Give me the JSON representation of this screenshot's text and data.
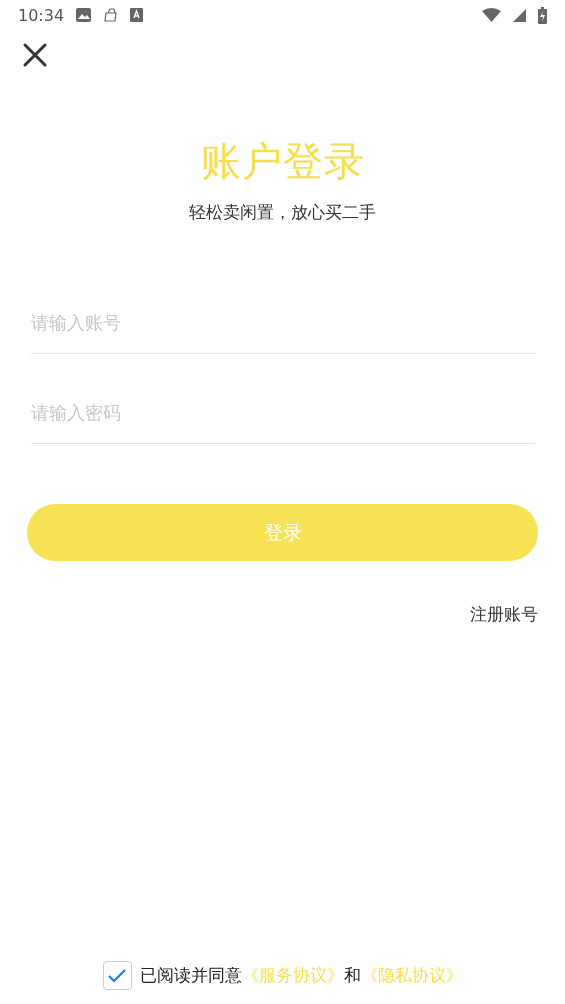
{
  "status_bar": {
    "time": "10:34"
  },
  "title": "账户登录",
  "subtitle": "轻松卖闲置，放心买二手",
  "fields": [
    {
      "placeholder": "请输入账号"
    },
    {
      "placeholder": "请输入密码"
    }
  ],
  "login_button": "登录",
  "register_link": "注册账号",
  "agreement": {
    "checked": true,
    "parts": [
      {
        "kind": "text",
        "text": "已阅读并同意"
      },
      {
        "kind": "link",
        "text": "《服务协议》"
      },
      {
        "kind": "text",
        "text": "和"
      },
      {
        "kind": "link",
        "text": "《隐私协议》"
      }
    ]
  }
}
